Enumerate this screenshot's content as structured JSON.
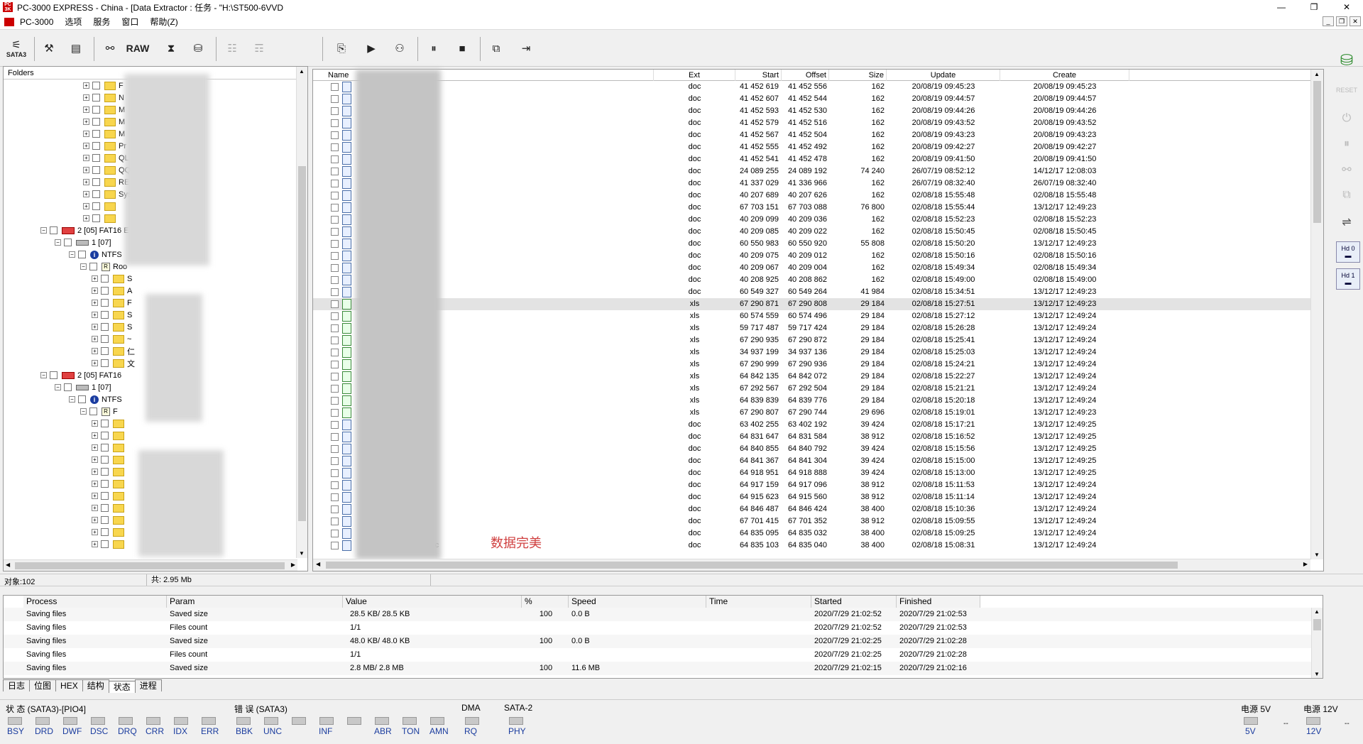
{
  "title": "PC-3000 EXPRESS - China - [Data Extractor : 任务 - \"H:\\ST500-6VVD",
  "window_buttons": [
    "—",
    "❐",
    "✕"
  ],
  "menu": [
    "PC-3000",
    "选项",
    "服务",
    "窗口",
    "帮助(Z)"
  ],
  "toolbar": {
    "sata_label": "SATA3",
    "raw_label": "RAW"
  },
  "left": {
    "header": "Folders",
    "tree": [
      {
        "indent": 1,
        "icon": "folder",
        "label": "F"
      },
      {
        "indent": 1,
        "icon": "folder",
        "label": "N"
      },
      {
        "indent": 1,
        "icon": "folder",
        "label": "M"
      },
      {
        "indent": 1,
        "icon": "folder",
        "label": "M"
      },
      {
        "indent": 1,
        "icon": "folder",
        "label": "M"
      },
      {
        "indent": 1,
        "icon": "folder",
        "label": "Pr"
      },
      {
        "indent": 1,
        "icon": "folder",
        "label": "QL"
      },
      {
        "indent": 1,
        "icon": "folder",
        "label": "QQ"
      },
      {
        "indent": 1,
        "icon": "folder",
        "label": "RE"
      },
      {
        "indent": 1,
        "icon": "folder",
        "label": "Syst"
      },
      {
        "indent": 1,
        "icon": "folder",
        "label": ""
      },
      {
        "indent": 1,
        "icon": "folder",
        "label": ""
      },
      {
        "indent": -2,
        "icon": "disk",
        "label": "2 [05] FAT16 E"
      },
      {
        "indent": -1,
        "icon": "hd",
        "label": "1 [07]"
      },
      {
        "indent": 0,
        "icon": "info",
        "label": "NTFS"
      },
      {
        "indent": 0.8,
        "icon": "root",
        "label": "Roo"
      },
      {
        "indent": 1.6,
        "icon": "folder",
        "label": "S"
      },
      {
        "indent": 1.6,
        "icon": "folder",
        "label": "A"
      },
      {
        "indent": 1.6,
        "icon": "folder",
        "label": "F"
      },
      {
        "indent": 1.6,
        "icon": "folder",
        "label": "S"
      },
      {
        "indent": 1.6,
        "icon": "folder",
        "label": "S"
      },
      {
        "indent": 1.6,
        "icon": "folder",
        "label": "~"
      },
      {
        "indent": 1.6,
        "icon": "folder",
        "label": "仁"
      },
      {
        "indent": 1.6,
        "icon": "folder",
        "label": "文"
      },
      {
        "indent": -2,
        "icon": "disk",
        "label": "2 [05] FAT16"
      },
      {
        "indent": -1,
        "icon": "hd",
        "label": "1 [07]"
      },
      {
        "indent": 0,
        "icon": "info",
        "label": "NTFS"
      },
      {
        "indent": 0.8,
        "icon": "root",
        "label": "F"
      },
      {
        "indent": 1.6,
        "icon": "folder",
        "label": ""
      },
      {
        "indent": 1.6,
        "icon": "folder",
        "label": ""
      },
      {
        "indent": 1.6,
        "icon": "folder",
        "label": ""
      },
      {
        "indent": 1.6,
        "icon": "folder",
        "label": ""
      },
      {
        "indent": 1.6,
        "icon": "folder",
        "label": ""
      },
      {
        "indent": 1.6,
        "icon": "folder",
        "label": ""
      },
      {
        "indent": 1.6,
        "icon": "folder",
        "label": ""
      },
      {
        "indent": 1.6,
        "icon": "folder",
        "label": ""
      },
      {
        "indent": 1.6,
        "icon": "folder",
        "label": ""
      },
      {
        "indent": 1.6,
        "icon": "folder",
        "label": ""
      },
      {
        "indent": 1.6,
        "icon": "folder",
        "label": ""
      }
    ]
  },
  "files": {
    "columns": [
      "Name",
      "Ext",
      "Start",
      "Offset",
      "Size",
      "Update",
      "Create"
    ],
    "rows": [
      [
        "E记",
        "doc",
        "41 452 619",
        "41 452 556",
        "162",
        "20/08/19 09:45:23",
        "20/08/19 09:45:23"
      ],
      [
        "E记",
        "doc",
        "41 452 607",
        "41 452 544",
        "162",
        "20/08/19 09:44:57",
        "20/08/19 09:44:57"
      ],
      [
        "E记",
        "doc",
        "41 452 593",
        "41 452 530",
        "162",
        "20/08/19 09:44:26",
        "20/08/19 09:44:26"
      ],
      [
        "",
        "doc",
        "41 452 579",
        "41 452 516",
        "162",
        "20/08/19 09:43:52",
        "20/08/19 09:43:52"
      ],
      [
        "",
        "doc",
        "41 452 567",
        "41 452 504",
        "162",
        "20/08/19 09:43:23",
        "20/08/19 09:43:23"
      ],
      [
        "",
        "doc",
        "41 452 555",
        "41 452 492",
        "162",
        "20/08/19 09:42:27",
        "20/08/19 09:42:27"
      ],
      [
        "",
        "doc",
        "41 452 541",
        "41 452 478",
        "162",
        "20/08/19 09:41:50",
        "20/08/19 09:41:50"
      ],
      [
        "1.doc",
        "doc",
        "24 089 255",
        "24 089 192",
        "74 240",
        "26/07/19 08:52:12",
        "14/12/17 12:08:03"
      ],
      [
        ".doc",
        "doc",
        "41 337 029",
        "41 336 966",
        "162",
        "26/07/19 08:32:40",
        "26/07/19 08:32:40"
      ],
      [
        ".doc",
        "doc",
        "40 207 689",
        "40 207 626",
        "162",
        "02/08/18 15:55:48",
        "02/08/18 15:55:48"
      ],
      [
        "表.doc",
        "doc",
        "67 703 151",
        "67 703 088",
        "76 800",
        "02/08/18 15:55:44",
        "13/12/17 12:49:23"
      ],
      [
        ".doc",
        "doc",
        "40 209 099",
        "40 209 036",
        "162",
        "02/08/18 15:52:23",
        "02/08/18 15:52:23"
      ],
      [
        "",
        "doc",
        "40 209 085",
        "40 209 022",
        "162",
        "02/08/18 15:50:45",
        "02/08/18 15:50:45"
      ],
      [
        "2.doc",
        "doc",
        "60 550 983",
        "60 550 920",
        "55 808",
        "02/08/18 15:50:20",
        "13/12/17 12:49:23"
      ],
      [
        ".doc",
        "doc",
        "40 209 075",
        "40 209 012",
        "162",
        "02/08/18 15:50:16",
        "02/08/18 15:50:16"
      ],
      [
        ".doc",
        "doc",
        "40 209 067",
        "40 209 004",
        "162",
        "02/08/18 15:49:34",
        "02/08/18 15:49:34"
      ],
      [
        "",
        "doc",
        "40 208 925",
        "40 208 862",
        "162",
        "02/08/18 15:49:00",
        "02/08/18 15:49:00"
      ],
      [
        ".doc",
        "doc",
        "60 549 327",
        "60 549 264",
        "41 984",
        "02/08/18 15:34:51",
        "13/12/17 12:49:23"
      ],
      [
        ".xls",
        "xls",
        "67 290 871",
        "67 290 808",
        "29 184",
        "02/08/18 15:27:51",
        "13/12/17 12:49:23"
      ],
      [
        "xls",
        "xls",
        "60 574 559",
        "60 574 496",
        "29 184",
        "02/08/18 15:27:12",
        "13/12/17 12:49:24"
      ],
      [
        "xls",
        "xls",
        "59 717 487",
        "59 717 424",
        "29 184",
        "02/08/18 15:26:28",
        "13/12/17 12:49:24"
      ],
      [
        "xls",
        "xls",
        "67 290 935",
        "67 290 872",
        "29 184",
        "02/08/18 15:25:41",
        "13/12/17 12:49:24"
      ],
      [
        "xls",
        "xls",
        "34 937 199",
        "34 937 136",
        "29 184",
        "02/08/18 15:25:03",
        "13/12/17 12:49:24"
      ],
      [
        "xls",
        "xls",
        "67 290 999",
        "67 290 936",
        "29 184",
        "02/08/18 15:24:21",
        "13/12/17 12:49:24"
      ],
      [
        "xls",
        "xls",
        "64 842 135",
        "64 842 072",
        "29 184",
        "02/08/18 15:22:27",
        "13/12/17 12:49:24"
      ],
      [
        "xls",
        "xls",
        "67 292 567",
        "67 292 504",
        "29 184",
        "02/08/18 15:21:21",
        "13/12/17 12:49:24"
      ],
      [
        "xls",
        "xls",
        "64 839 839",
        "64 839 776",
        "29 184",
        "02/08/18 15:20:18",
        "13/12/17 12:49:24"
      ],
      [
        "xls",
        "xls",
        "67 290 807",
        "67 290 744",
        "29 696",
        "02/08/18 15:19:01",
        "13/12/17 12:49:23"
      ],
      [
        "doc",
        "doc",
        "63 402 255",
        "63 402 192",
        "39 424",
        "02/08/18 15:17:21",
        "13/12/17 12:49:25"
      ],
      [
        "doc",
        "doc",
        "64 831 647",
        "64 831 584",
        "38 912",
        "02/08/18 15:16:52",
        "13/12/17 12:49:25"
      ],
      [
        "doc",
        "doc",
        "64 840 855",
        "64 840 792",
        "39 424",
        "02/08/18 15:15:56",
        "13/12/17 12:49:25"
      ],
      [
        "doc",
        "doc",
        "64 841 367",
        "64 841 304",
        "39 424",
        "02/08/18 15:15:00",
        "13/12/17 12:49:25"
      ],
      [
        "doc",
        "doc",
        "64 918 951",
        "64 918 888",
        "39 424",
        "02/08/18 15:13:00",
        "13/12/17 12:49:25"
      ],
      [
        "2.doc",
        "doc",
        "64 917 159",
        "64 917 096",
        "38 912",
        "02/08/18 15:11:53",
        "13/12/17 12:49:24"
      ],
      [
        "-1.doc",
        "doc",
        "64 915 623",
        "64 915 560",
        "38 912",
        "02/08/18 15:11:14",
        "13/12/17 12:49:24"
      ],
      [
        "2.doc",
        "doc",
        "64 846 487",
        "64 846 424",
        "38 400",
        "02/08/18 15:10:36",
        "13/12/17 12:49:24"
      ],
      [
        "1-1.doc",
        "doc",
        "67 701 415",
        "67 701 352",
        "38 912",
        "02/08/18 15:09:55",
        "13/12/17 12:49:24"
      ],
      [
        "11.doc",
        "doc",
        "64 835 095",
        "64 835 032",
        "38 400",
        "02/08/18 15:09:25",
        "13/12/17 12:49:24"
      ],
      [
        "10 漆.doc",
        "doc",
        "64 835 103",
        "64 835 040",
        "38 400",
        "02/08/18 15:08:31",
        "13/12/17 12:49:24"
      ]
    ],
    "watermark": "数据完美"
  },
  "statusbar": {
    "objects": "对象:102",
    "total": "共: 2.95 Mb"
  },
  "log": {
    "columns": [
      "Process",
      "Param",
      "Value",
      "%",
      "Speed",
      "Time",
      "Started",
      "Finished"
    ],
    "rows": [
      [
        "Saving files",
        "Saved size",
        "28.5 KB/ 28.5 KB",
        "100",
        "0.0 B",
        "",
        "2020/7/29 21:02:52",
        "2020/7/29 21:02:53"
      ],
      [
        "Saving files",
        "Files count",
        "1/1",
        "",
        "",
        "",
        "2020/7/29 21:02:52",
        "2020/7/29 21:02:53"
      ],
      [
        "Saving files",
        "Saved size",
        "48.0 KB/ 48.0 KB",
        "100",
        "0.0 B",
        "",
        "2020/7/29 21:02:25",
        "2020/7/29 21:02:28"
      ],
      [
        "Saving files",
        "Files count",
        "1/1",
        "",
        "",
        "",
        "2020/7/29 21:02:25",
        "2020/7/29 21:02:28"
      ],
      [
        "Saving files",
        "Saved size",
        "2.8 MB/ 2.8 MB",
        "100",
        "11.6 MB",
        "",
        "2020/7/29 21:02:15",
        "2020/7/29 21:02:16"
      ]
    ]
  },
  "tabs": [
    "日志",
    "位图",
    "HEX",
    "结构",
    "状态",
    "进程"
  ],
  "bottom": {
    "status_title": "状 态 (SATA3)-[PIO4]",
    "status_leds": [
      "BSY",
      "DRD",
      "DWF",
      "DSC",
      "DRQ",
      "CRR",
      "IDX",
      "ERR"
    ],
    "error_title": "错 误 (SATA3)",
    "error_leds": [
      "BBK",
      "UNC",
      "",
      "INF",
      "",
      "ABR",
      "TON",
      "AMN"
    ],
    "dma_title": "DMA",
    "dma_leds": [
      "RQ"
    ],
    "sata_title": "SATA-2",
    "sata_leds": [
      "PHY"
    ],
    "power5_title": "电源 5V",
    "power5_led": "5V",
    "power5_val": "--",
    "power12_title": "电源 12V",
    "power12_led": "12V",
    "power12_val": "--"
  },
  "sidebar": {
    "reset": "RESET",
    "hd0": "Hd 0",
    "hd1": "Hd 1"
  }
}
